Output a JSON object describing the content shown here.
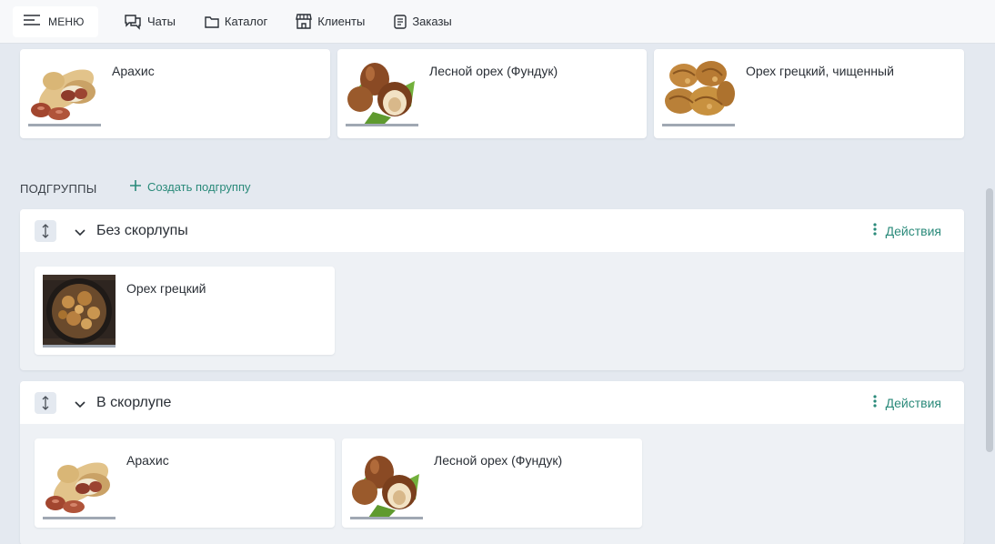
{
  "topbar": {
    "menu_label": "МЕНЮ",
    "nav": [
      {
        "label": "Чаты",
        "icon": "chat-icon"
      },
      {
        "label": "Каталог",
        "icon": "folder-icon"
      },
      {
        "label": "Клиенты",
        "icon": "store-icon"
      },
      {
        "label": "Заказы",
        "icon": "document-icon"
      }
    ]
  },
  "top_products": [
    {
      "title": "Арахис",
      "image": "peanut-image"
    },
    {
      "title": "Лесной орех (Фундук)",
      "image": "hazelnut-image"
    },
    {
      "title": "Орех грецкий, чищенный",
      "image": "walnut-image"
    }
  ],
  "subgroups": {
    "label": "ПОДГРУППЫ",
    "create_label": "Создать подгруппу",
    "groups": [
      {
        "title": "Без скорлупы",
        "actions_label": "Действия",
        "products": [
          {
            "title": "Орех грецкий",
            "image": "walnut-bowl-image"
          }
        ]
      },
      {
        "title": "В скорлупе",
        "actions_label": "Действия",
        "products": [
          {
            "title": "Арахис",
            "image": "peanut-image"
          },
          {
            "title": "Лесной орех (Фундук)",
            "image": "hazelnut-image"
          }
        ]
      }
    ]
  },
  "colors": {
    "accent": "#2a8a7a",
    "background": "#e4e9f0",
    "card": "#ffffff",
    "text": "#2a2f36"
  }
}
